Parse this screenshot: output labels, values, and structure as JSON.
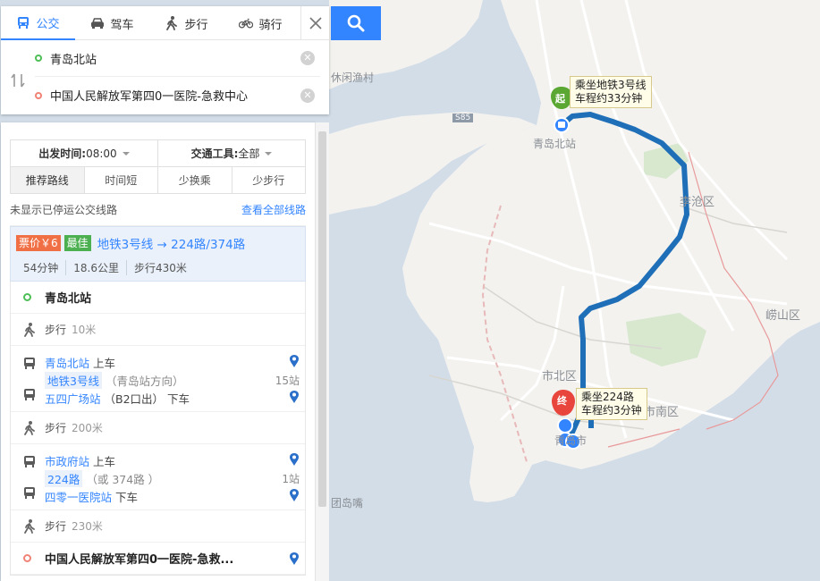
{
  "mode_tabs": [
    {
      "label": "公交",
      "icon": "bus-icon",
      "active": true
    },
    {
      "label": "驾车",
      "icon": "car-icon",
      "active": false
    },
    {
      "label": "步行",
      "icon": "walk-icon",
      "active": false
    },
    {
      "label": "骑行",
      "icon": "bike-icon",
      "active": false
    }
  ],
  "route": {
    "start": "青岛北站",
    "end": "中国人民解放军第四0一医院-急救中心"
  },
  "filters": {
    "depart_label": "出发时间:",
    "depart_value": "08:00",
    "tool_label": "交通工具:",
    "tool_value": "全部"
  },
  "sort_tabs": [
    "推荐路线",
    "时间短",
    "少换乘",
    "少步行"
  ],
  "notice": "未显示已停运公交线路",
  "view_all": "查看全部线路",
  "plan": {
    "price": "票价￥6",
    "best": "最佳",
    "title": "地铁3号线 → 224路/374路",
    "duration": "54分钟",
    "distance": "18.6公里",
    "walk": "步行430米"
  },
  "steps": {
    "start_station": "青岛北站",
    "walk1_label": "步行",
    "walk1_dist": "10米",
    "seg1": {
      "board_station": "青岛北站",
      "board_action": "上车",
      "line": "地铁3号线",
      "direction": "（青岛站方向）",
      "stops": "15站",
      "alight_station": "五四广场站",
      "alight_note": "（B2口出）",
      "alight_action": "下车"
    },
    "walk2_label": "步行",
    "walk2_dist": "200米",
    "seg2": {
      "board_station": "市政府站",
      "board_action": "上车",
      "line": "224路",
      "direction": "（或 374路 ）",
      "stops": "1站",
      "alight_station": "四零一医院站",
      "alight_action": "下车"
    },
    "walk3_label": "步行",
    "walk3_dist": "230米",
    "end_station": "中国人民解放军第四0一医院-急救..."
  },
  "map": {
    "bubble_start_line1": "乘坐地铁3号线",
    "bubble_start_line2": "车程约33分钟",
    "bubble_end_line1": "乘坐224路",
    "bubble_end_line2": "车程约3分钟",
    "start_marker": "起",
    "end_marker": "终",
    "labels": {
      "qingdao_north": "青岛北站",
      "licang": "李沧区",
      "laoshan": "崂山区",
      "shibei": "市北区",
      "shinan": "市南区",
      "qingdaoshi": "青岛市",
      "tuandaozui": "团岛嘴",
      "xiuxian": "休闲渔村",
      "road_s85": "S85"
    },
    "colors": {
      "route": "#1f6fb8",
      "sea": "#d3dde8",
      "land": "#f3f2ef",
      "green": "#d7e8cf",
      "boundary": "#e89a9a"
    }
  }
}
